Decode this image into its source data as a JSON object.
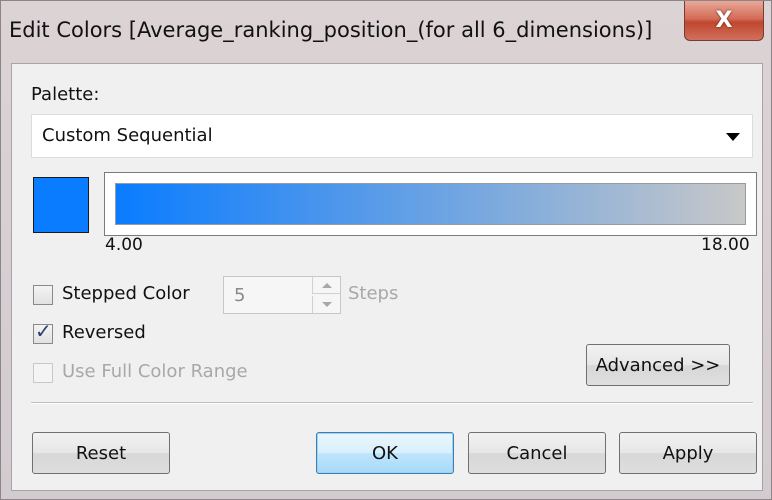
{
  "window": {
    "title": "Edit Colors [Average_ranking_position_(for all 6_dimensions)]",
    "close_symbol": "X"
  },
  "palette": {
    "label": "Palette:",
    "selected": "Custom Sequential"
  },
  "ramp": {
    "start_color": "#0a7cff",
    "end_color": "#c8c8c8",
    "min_label": "4.00",
    "max_label": "18.00"
  },
  "options": {
    "stepped_color": {
      "label": "Stepped Color",
      "checked": false
    },
    "steps": {
      "value": "5",
      "label": "Steps"
    },
    "reversed": {
      "label": "Reversed",
      "checked": true
    },
    "use_full_range": {
      "label": "Use Full Color Range",
      "checked": false,
      "enabled": false
    }
  },
  "buttons": {
    "advanced": "Advanced >>",
    "reset": "Reset",
    "ok": "OK",
    "cancel": "Cancel",
    "apply": "Apply"
  },
  "colors": {
    "disabled_text": "#a8a8a8",
    "checkmark": "#2a3f6a"
  }
}
